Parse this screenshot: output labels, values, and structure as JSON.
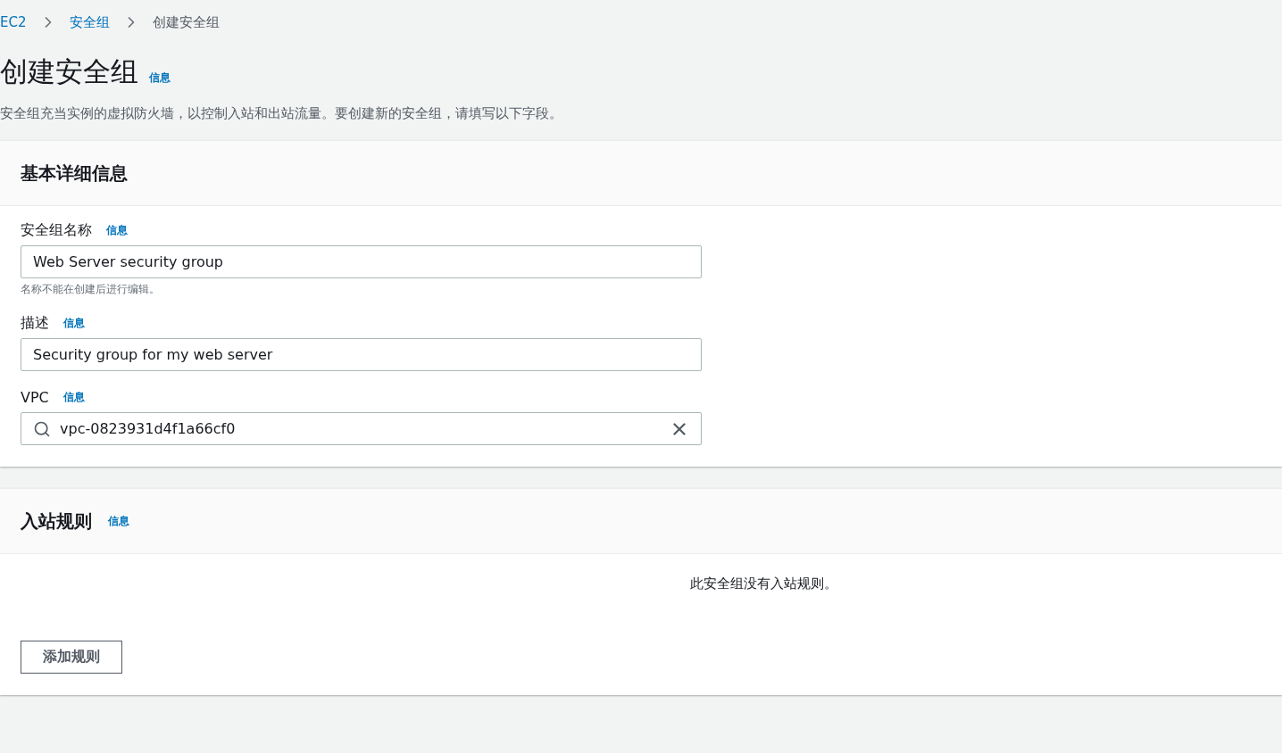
{
  "breadcrumbs": [
    {
      "label": "EC2",
      "link": true
    },
    {
      "label": "安全组",
      "link": true
    },
    {
      "label": "创建安全组",
      "link": false
    }
  ],
  "page": {
    "title": "创建安全组",
    "info": "信息",
    "description": "安全组充当实例的虚拟防火墙，以控制入站和出站流量。要创建新的安全组，请填写以下字段。"
  },
  "basic_details": {
    "title": "基本详细信息",
    "fields": [
      {
        "kind": "text",
        "label": "安全组名称",
        "info": "信息",
        "value": "Web Server security group",
        "hint": "名称不能在创建后进行编辑。"
      },
      {
        "kind": "text",
        "label": "描述",
        "info": "信息",
        "value": "Security group for my web server"
      },
      {
        "kind": "search",
        "label": "VPC",
        "info": "信息",
        "value": "vpc-0823931d4f1a66cf0"
      }
    ]
  },
  "inbound_rules": {
    "title": "入站规则",
    "info": "信息",
    "empty_message": "此安全组没有入站规则。",
    "add_button": "添加规则"
  }
}
